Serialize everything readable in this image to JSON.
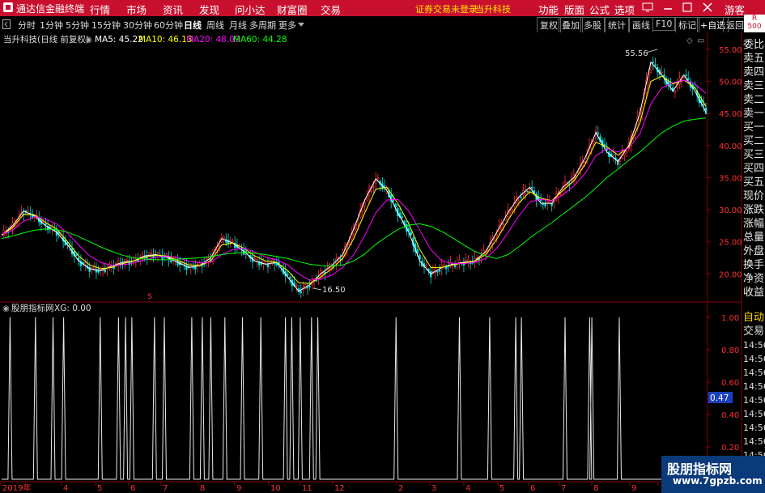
{
  "app": {
    "title": "通达信金融终端",
    "menu": [
      "行情",
      "市场",
      "资讯",
      "发现",
      "问小达",
      "财富圈",
      "交易"
    ],
    "notice": "证券交易未登录",
    "stock_name_top": "当升科技",
    "right_menu": [
      "功能",
      "版面",
      "公式",
      "选项"
    ],
    "user": "游客",
    "badge_line1": "R",
    "badge_line2": "500"
  },
  "toolbar": {
    "periods": [
      "分时",
      "1分钟",
      "5分钟",
      "15分钟",
      "30分钟",
      "60分钟",
      "日线",
      "周线",
      "月线",
      "多周期",
      "更多"
    ],
    "active_period": "日线",
    "right_buttons": [
      "复权",
      "叠加",
      "多股",
      "统计",
      "画线",
      "F10",
      "标记",
      "+自选",
      "返回"
    ]
  },
  "main_chart": {
    "title": "当升科技(日线 前复权)",
    "ma": [
      {
        "label": "MA5: 45.22",
        "color": "#ffffff"
      },
      {
        "label": "MA10: 46.13",
        "color": "#ffff00"
      },
      {
        "label": "MA20: 48.09",
        "color": "#ff00ff"
      },
      {
        "label": "MA60: 44.28",
        "color": "#00ff00"
      }
    ],
    "high_label": "55.56",
    "low_label": "16.50",
    "marker_s": "S",
    "y_ticks": [
      "55.00",
      "50.00",
      "45.00",
      "40.00",
      "35.00",
      "30.00",
      "25.00",
      "20.00"
    ]
  },
  "side_panel": [
    "委比",
    "卖五",
    "卖四",
    "卖三",
    "卖二",
    "卖一",
    "买一",
    "买二",
    "买三",
    "买四",
    "买五",
    "现价",
    "涨跌",
    "涨幅",
    "总量",
    "外盘",
    "换手",
    "净资",
    "收益"
  ],
  "indicator": {
    "title": "股朋指标网",
    "xg": "XG: 0.00",
    "y_ticks": [
      "1.00",
      "0.80",
      "0.60",
      "0.40",
      "0.20"
    ],
    "current": "0.47",
    "side_labels": [
      "自动",
      "交易",
      "14:56",
      "14:56",
      "14:56",
      "14:56",
      "14:56",
      "14:56",
      "14:56",
      "14:56",
      "14:56",
      "14:56"
    ]
  },
  "x_axis": [
    "2019年",
    "4",
    "5",
    "6",
    "7",
    "8",
    "9",
    "10",
    "11",
    "12",
    "2",
    "3",
    "4",
    "5",
    "6",
    "7",
    "8",
    "9",
    "10"
  ],
  "watermark": {
    "line1": "股朋指标网",
    "line2": "www.7gpzb.com"
  },
  "chart_data": {
    "type": "line",
    "title": "当升科技(日线 前复权)",
    "ylim": [
      16,
      57
    ],
    "series": [
      {
        "name": "MA5",
        "color": "#ffffff",
        "values": [
          26.0,
          27.5,
          29.8,
          29.0,
          27.5,
          26.5,
          24.5,
          22.0,
          20.8,
          20.5,
          21.2,
          21.8,
          22.0,
          22.8,
          23.0,
          22.6,
          21.8,
          21.0,
          21.3,
          22.5,
          25.5,
          24.8,
          23.5,
          22.0,
          21.5,
          21.8,
          19.5,
          17.3,
          18.3,
          20.0,
          21.3,
          23.0,
          27.0,
          31.5,
          34.8,
          33.0,
          29.5,
          26.5,
          22.0,
          20.0,
          21.0,
          21.5,
          21.8,
          22.0,
          23.5,
          26.5,
          29.5,
          32.0,
          33.5,
          31.0,
          31.0,
          33.5,
          35.0,
          38.0,
          42.0,
          39.0,
          37.5,
          40.0,
          45.0,
          53.0,
          51.0,
          48.5,
          51.0,
          48.5,
          45.2
        ]
      },
      {
        "name": "MA10",
        "color": "#ffff00",
        "values": [
          26.1,
          27.2,
          29.3,
          29.2,
          28.0,
          27.0,
          25.0,
          22.8,
          21.4,
          20.8,
          21.0,
          21.6,
          22.0,
          22.6,
          22.9,
          22.8,
          22.1,
          21.4,
          21.3,
          22.0,
          24.5,
          24.8,
          24.0,
          22.8,
          22.0,
          21.8,
          20.5,
          18.6,
          18.5,
          19.5,
          20.8,
          22.4,
          25.5,
          29.5,
          33.2,
          33.5,
          31.0,
          27.8,
          23.8,
          21.0,
          21.0,
          21.4,
          21.7,
          22.0,
          23.0,
          25.4,
          28.3,
          31.0,
          32.8,
          31.8,
          31.4,
          33.0,
          34.5,
          37.0,
          40.5,
          39.8,
          38.5,
          39.8,
          43.5,
          50.0,
          50.8,
          49.6,
          50.2,
          49.0,
          46.1
        ]
      },
      {
        "name": "MA20",
        "color": "#ff00ff",
        "values": [
          26.2,
          26.8,
          28.2,
          28.9,
          28.5,
          27.8,
          26.3,
          24.5,
          22.8,
          21.8,
          21.3,
          21.4,
          21.7,
          22.2,
          22.6,
          22.8,
          22.5,
          22.0,
          21.7,
          21.8,
          23.0,
          23.8,
          24.0,
          23.4,
          22.6,
          22.2,
          21.4,
          20.0,
          19.0,
          19.2,
          19.8,
          21.0,
          23.0,
          26.0,
          29.5,
          31.5,
          31.6,
          29.8,
          26.8,
          23.8,
          22.0,
          21.6,
          21.6,
          21.8,
          22.4,
          24.0,
          26.4,
          29.0,
          31.2,
          31.6,
          31.4,
          32.3,
          33.7,
          35.6,
          38.4,
          39.5,
          39.0,
          39.6,
          41.8,
          46.5,
          49.0,
          49.8,
          50.2,
          49.6,
          48.1
        ]
      },
      {
        "name": "MA60",
        "color": "#00ff00",
        "values": [
          25.5,
          25.9,
          26.4,
          26.8,
          27.0,
          26.9,
          26.5,
          25.8,
          25.0,
          24.2,
          23.5,
          22.9,
          22.5,
          22.3,
          22.2,
          22.2,
          22.3,
          22.4,
          22.5,
          22.7,
          23.0,
          23.2,
          23.3,
          23.2,
          23.0,
          22.7,
          22.4,
          21.9,
          21.5,
          21.3,
          21.2,
          21.4,
          22.0,
          23.1,
          24.6,
          25.8,
          26.9,
          27.6,
          27.8,
          27.4,
          26.6,
          25.6,
          24.5,
          23.5,
          22.8,
          22.4,
          23.0,
          24.2,
          25.6,
          26.8,
          28.0,
          29.3,
          30.6,
          31.9,
          33.4,
          35.0,
          36.3,
          37.7,
          39.0,
          40.5,
          42.0,
          43.0,
          43.8,
          44.1,
          44.3
        ]
      }
    ],
    "indicator_series": {
      "name": "XG",
      "ylim": [
        0,
        1
      ],
      "signal_x": [
        0.012,
        0.048,
        0.073,
        0.088,
        0.14,
        0.166,
        0.176,
        0.185,
        0.217,
        0.231,
        0.27,
        0.285,
        0.297,
        0.317,
        0.342,
        0.368,
        0.403,
        0.412,
        0.424,
        0.44,
        0.449,
        0.56,
        0.65,
        0.693,
        0.73,
        0.738,
        0.8,
        0.835,
        0.838,
        0.877
      ]
    }
  }
}
